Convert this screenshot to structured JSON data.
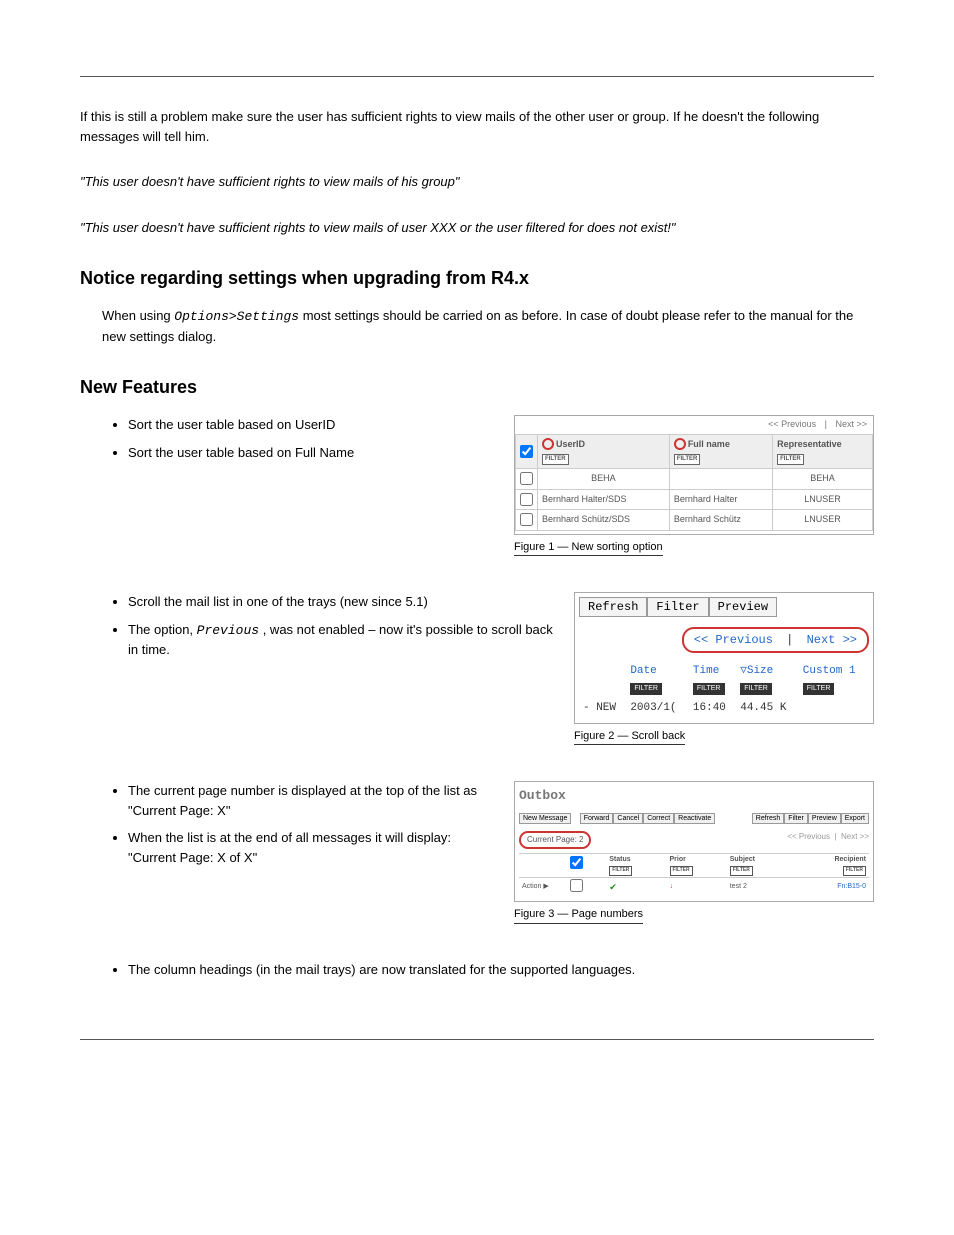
{
  "page_header": {
    "left": "",
    "right": ""
  },
  "page_footer": {
    "left": "",
    "right": ""
  },
  "intro_1": "If this is still a problem make sure the user has sufficient rights to view mails of the other user or group. If he doesn't the following messages will tell him.",
  "quote_1": "\"This user doesn't have sufficient rights to view mails of his group\"",
  "quote_2": "\"This user doesn't have sufficient rights to view mails of user XXX or the user filtered for does not exist!\"",
  "notice_heading": "Notice regarding settings when upgrading from R4.x",
  "notice_body_1": "When using ",
  "notice_code": "Options>Settings",
  "notice_body_2": " most settings should be carried on as before. In case of doubt please refer to the manual for the new settings dialog.",
  "new_heading": "New Features",
  "feature_sort": {
    "bullet1": "Sort the user table based on UserID",
    "bullet2": "Sort the user table based on Full Name"
  },
  "fig1": {
    "pager_prev": "<< Previous",
    "pager_next": "Next >>",
    "col_userid": "UserID",
    "col_fullname": "Full name",
    "col_rep": "Representative",
    "filter": "FILTER",
    "rows": [
      {
        "uid": "BEHA",
        "name": "",
        "rep": "BEHA"
      },
      {
        "uid": "Bernhard Halter/SDS",
        "name": "Bernhard Halter",
        "rep": "LNUSER"
      },
      {
        "uid": "Bernhard Schütz/SDS",
        "name": "Bernhard Schütz",
        "rep": "LNUSER"
      }
    ],
    "caption": "Figure 1 — New sorting option"
  },
  "feature_scroll": {
    "bullet1": "Scroll the mail list in one of the trays (new since 5.1)",
    "bullet2_a": "The option, ",
    "bullet2_code": "Previous",
    "bullet2_b": ", was not enabled – now it's possible to scroll back in time."
  },
  "fig2": {
    "btn_refresh": "Refresh",
    "btn_filter": "Filter",
    "btn_preview": "Preview",
    "pager_prev": "<< Previous",
    "pager_next": "Next >>",
    "col_date": "Date",
    "col_time": "Time",
    "col_size": "Size",
    "col_custom": "Custom 1",
    "filter": "FILTER",
    "row_status": "- NEW",
    "row_date": "2003/1(",
    "row_time": "16:40",
    "row_size": "44.45 K",
    "caption": "Figure 2 — Scroll back"
  },
  "feature_page": {
    "bullet1_a": "The current page number is displayed at the top of the list as ",
    "bullet1_q": "\"Current Page: X\"",
    "bullet2_a": "When the list is at the end of all messages it will display: ",
    "bullet2_q": "\"Current Page: X of X\""
  },
  "fig3": {
    "title": "Outbox",
    "btn_new": "New Message",
    "btn_forward": "Forward",
    "btn_cancel": "Cancel",
    "btn_correct": "Correct",
    "btn_reactivate": "Reactivate",
    "btn_refresh": "Refresh",
    "btn_filter": "Filter",
    "btn_preview": "Preview",
    "btn_export": "Export",
    "current_page": "Current Page: 2",
    "pager_prev": "<< Previous",
    "pager_next": "Next >>",
    "col_status": "Status",
    "col_prior": "Prior",
    "col_subject": "Subject",
    "col_recipient": "Recipient",
    "filter": "FILTER",
    "action_label": "Action ▶",
    "row_subject": "test 2",
    "row_recipient": "Fn:B15-0",
    "caption": "Figure 3 — Page numbers"
  },
  "feature_last_bullet": "The column headings (in the mail trays) are now translated for the supported languages."
}
